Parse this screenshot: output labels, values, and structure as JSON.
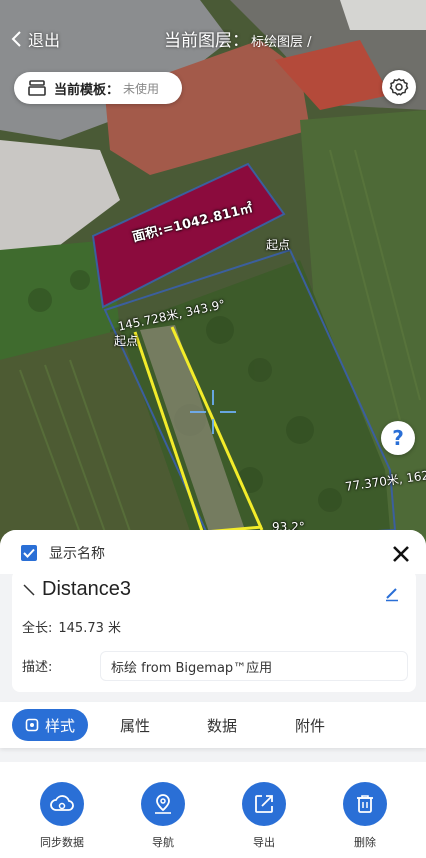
{
  "header": {
    "back_label": "退出",
    "title": "当前图层：",
    "layer_path": "标绘图层 /"
  },
  "template": {
    "label": "当前模板：",
    "value": "未使用"
  },
  "map": {
    "area_label": "面积:=1042.811㎡",
    "start_label_right": "起点",
    "start_label_left": "起点",
    "segment_label": "145.728米, 343.9°",
    "edge_label": "77.370米, 162",
    "bottom_edge_label": "93.2°",
    "colors": {
      "polygon_fill": "#8b0b3d",
      "line": "#f3ec2a",
      "outline": "#3b5f9e"
    }
  },
  "sheet": {
    "show_name_label": "显示名称",
    "show_name_checked": true,
    "feature_name": "Distance3",
    "length_label": "全长:",
    "length_value": "145.73 米",
    "desc_label": "描述:",
    "desc_value": "标绘 from Bigemap™应用",
    "tabs": [
      {
        "label": "样式",
        "active": true
      },
      {
        "label": "属性"
      },
      {
        "label": "数据"
      },
      {
        "label": "附件"
      }
    ],
    "actions": [
      {
        "label": "同步数据",
        "icon": "cloud-sync-icon"
      },
      {
        "label": "导航",
        "icon": "map-pin-icon"
      },
      {
        "label": "导出",
        "icon": "export-icon"
      },
      {
        "label": "删除",
        "icon": "trash-icon"
      }
    ],
    "accent": "#2a6fd6"
  }
}
